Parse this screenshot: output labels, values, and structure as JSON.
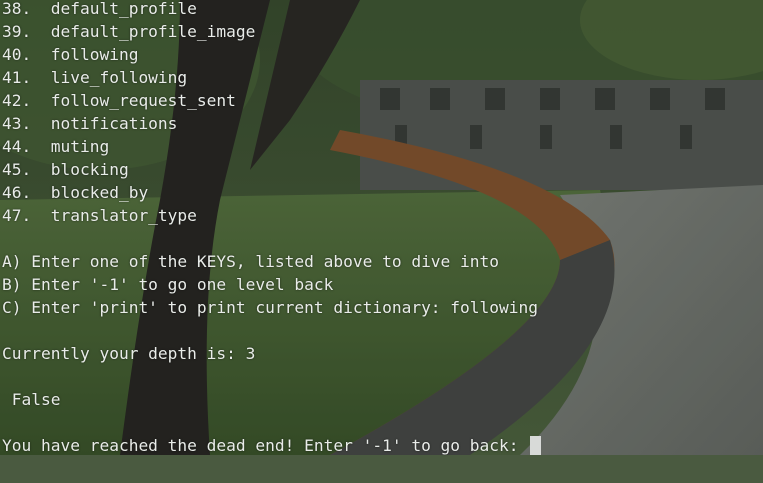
{
  "terminal": {
    "key_list": [
      "38.  default_profile",
      "39.  default_profile_image",
      "40.  following",
      "41.  live_following",
      "42.  follow_request_sent",
      "43.  notifications",
      "44.  muting",
      "45.  blocking",
      "46.  blocked_by",
      "47.  translator_type"
    ],
    "options": {
      "a": "A) Enter one of the KEYS, listed above to dive into",
      "b": "B) Enter '-1' to go one level back",
      "c": "C) Enter 'print' to print current dictionary: following"
    },
    "depth_line": "Currently your depth is: 3",
    "value_line": " False",
    "prompt_line": "You have reached the dead end! Enter '-1' to go back: "
  },
  "colors": {
    "text": "#e9ece9",
    "cursor": "#d8dad8"
  }
}
